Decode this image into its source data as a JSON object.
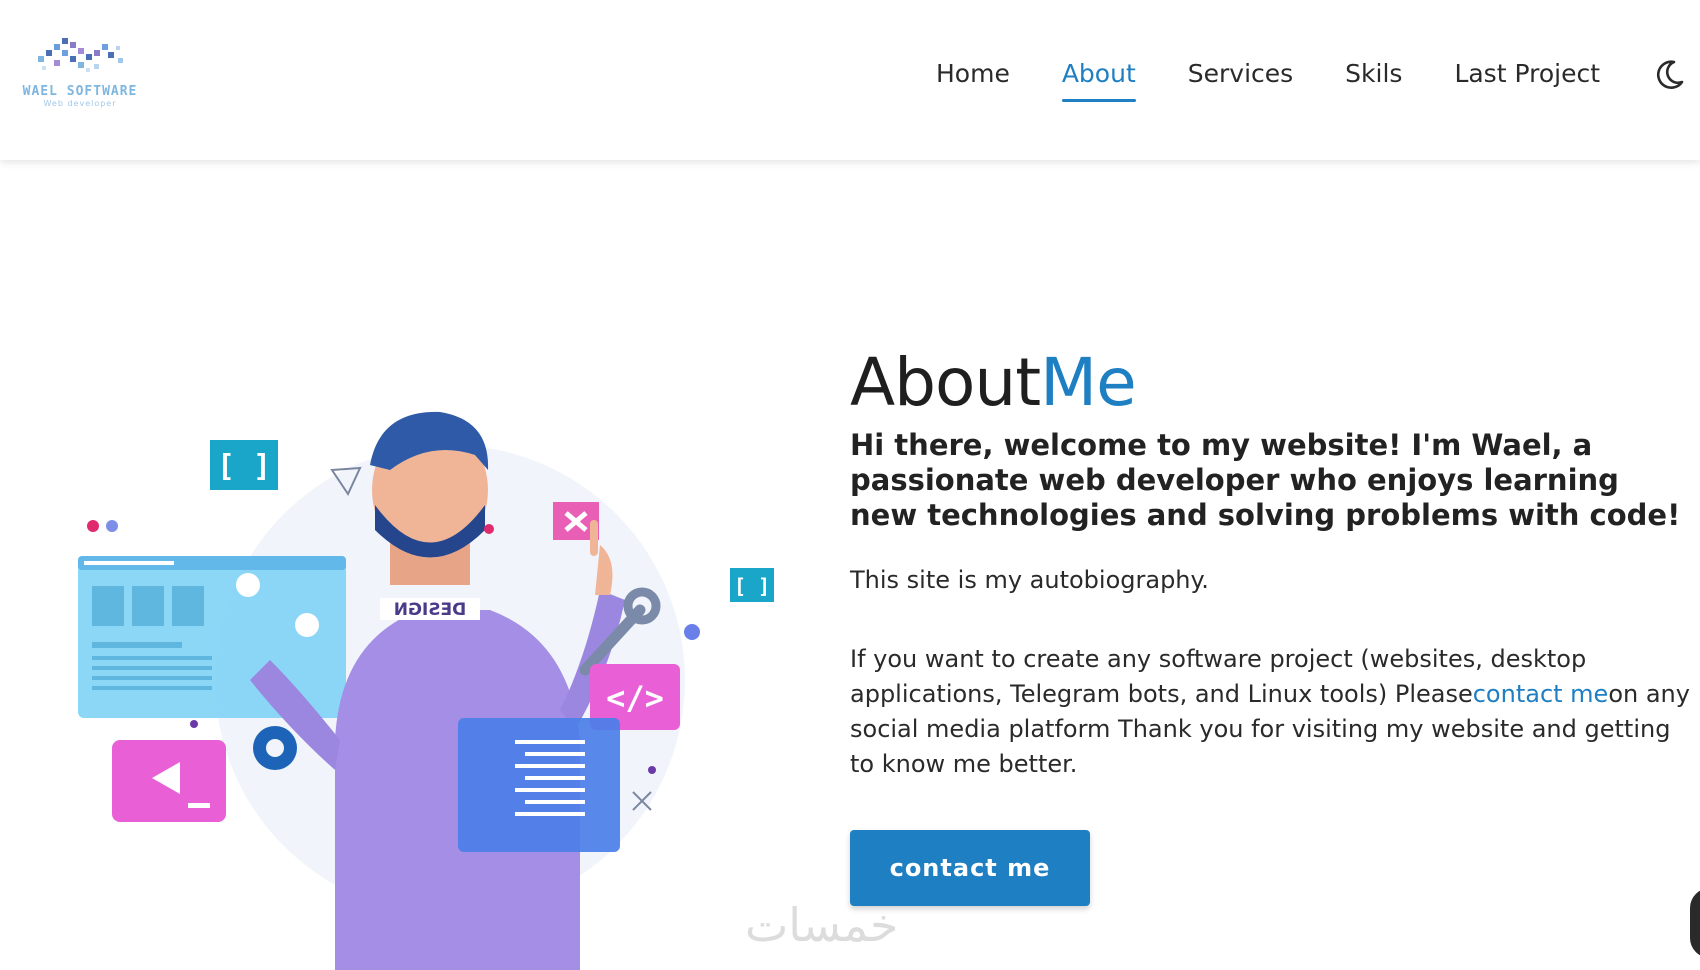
{
  "logo": {
    "title": "WAEL SOFTWARE",
    "subtitle": "Web developer"
  },
  "nav": {
    "items": [
      {
        "label": "Home",
        "active": false
      },
      {
        "label": "About",
        "active": true
      },
      {
        "label": "Services",
        "active": false
      },
      {
        "label": "Skils",
        "active": false
      },
      {
        "label": "Last Project",
        "active": false
      }
    ],
    "theme_icon": "moon-icon"
  },
  "about": {
    "title_main": "About",
    "title_accent": "Me",
    "lead": "Hi there, welcome to my website! I'm Wael, a passionate web developer who enjoys learning new technologies and solving problems with code!",
    "paragraph1": "This site is my autobiography.",
    "paragraph2_before": "If you want to create any software project (websites, desktop applications, Telegram bots, and Linux tools) Please",
    "paragraph2_link": "contact me",
    "paragraph2_after": "on any social media platform Thank you for visiting my website and getting to know me better.",
    "button_label": "contact me"
  },
  "illustration": {
    "shirt_text": "DESIGN",
    "bracket_label": "[ ]",
    "code_label": "</>"
  },
  "watermark": "خمسات",
  "colors": {
    "accent": "#1e7fc2",
    "text": "#222222",
    "background": "#ffffff"
  }
}
